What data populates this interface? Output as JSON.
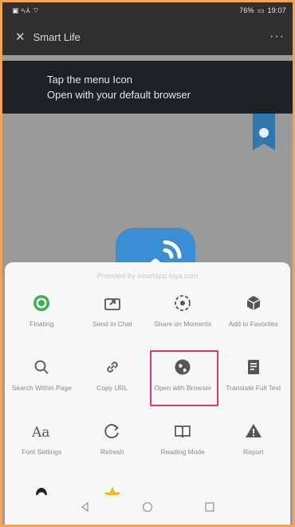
{
  "status_bar": {
    "left_text": "▣ ᵊᵣ⅄ ⌔",
    "battery": "76%",
    "time": "19:07"
  },
  "appbar": {
    "title": "Smart Life",
    "close_icon": "close-icon",
    "more_icon": "more-icon"
  },
  "banner": {
    "line1": "Tap the menu Icon",
    "line2": "Open with your default browser"
  },
  "sheet": {
    "provided_by": "Provided by smartapp.tuya.com",
    "items": [
      {
        "label": "Floating",
        "icon": "floating-icon"
      },
      {
        "label": "Send to Chat",
        "icon": "send-icon"
      },
      {
        "label": "Share on Moments",
        "icon": "moments-icon"
      },
      {
        "label": "Add to Favorites",
        "icon": "favorites-icon"
      },
      {
        "label": "Search Within Page",
        "icon": "search-icon"
      },
      {
        "label": "Copy URL",
        "icon": "link-icon"
      },
      {
        "label": "Open with Browser",
        "icon": "browser-icon"
      },
      {
        "label": "Translate Full Text",
        "icon": "translate-icon"
      },
      {
        "label": "Font Settings",
        "icon": "font-icon"
      },
      {
        "label": "Refresh",
        "icon": "refresh-icon"
      },
      {
        "label": "Reading Mode",
        "icon": "book-icon"
      },
      {
        "label": "Report",
        "icon": "warning-icon"
      },
      {
        "label": "",
        "icon": "qq-icon"
      },
      {
        "label": "",
        "icon": "star-icon"
      }
    ]
  },
  "colors": {
    "accent_green": "#3bb34a",
    "highlight": "#e2357a",
    "ribbon_blue": "#2f77b0"
  }
}
